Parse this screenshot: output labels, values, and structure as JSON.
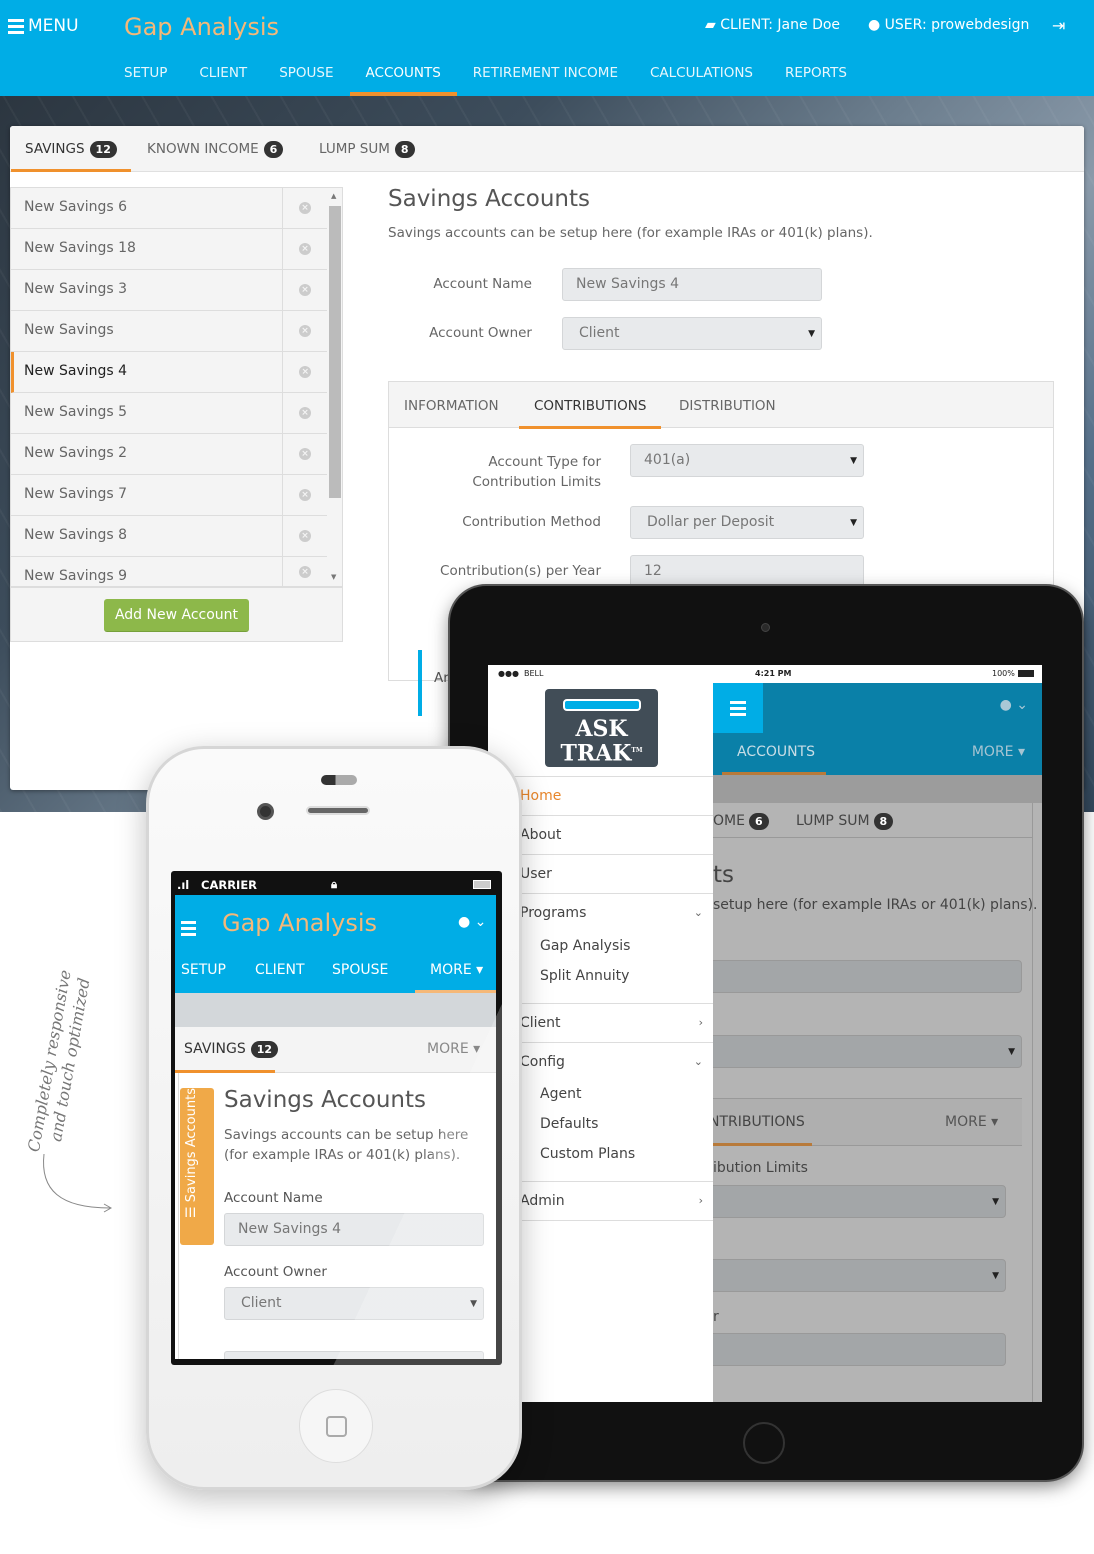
{
  "header": {
    "menu_label": "MENU",
    "app_title": "Gap Analysis",
    "client_label": "CLIENT: Jane Doe",
    "user_label": "USER: prowebdesign",
    "nav_tabs": [
      "SETUP",
      "CLIENT",
      "SPOUSE",
      "ACCOUNTS",
      "RETIREMENT INCOME",
      "CALCULATIONS",
      "REPORTS"
    ],
    "active_tab": "ACCOUNTS"
  },
  "subtabs": [
    {
      "label": "SAVINGS",
      "count": "12"
    },
    {
      "label": "KNOWN INCOME",
      "count": "6"
    },
    {
      "label": "LUMP SUM",
      "count": "8"
    }
  ],
  "accounts_list": {
    "items": [
      "New Savings 6",
      "New Savings 18",
      "New Savings 3",
      "New Savings",
      "New Savings 4",
      "New Savings 5",
      "New Savings 2",
      "New Savings 7",
      "New Savings 8",
      "New Savings 9"
    ],
    "selected": "New Savings 4",
    "add_button": "Add New Account"
  },
  "form": {
    "title": "Savings Accounts",
    "description": "Savings accounts can be setup here (for example IRAs or 401(k) plans).",
    "account_name_label": "Account Name",
    "account_name_value": "New Savings 4",
    "account_owner_label": "Account Owner",
    "account_owner_value": "Client",
    "inner_tabs": [
      "INFORMATION",
      "CONTRIBUTIONS",
      "DISTRIBUTION"
    ],
    "inner_active": "CONTRIBUTIONS",
    "account_type_label_1": "Account Type for",
    "account_type_label_2": "Contribution Limits",
    "account_type_value": "401(a)",
    "contribution_method_label": "Contribution Method",
    "contribution_method_value": "Dollar per Deposit",
    "contributions_per_year_label": "Contribution(s) per Year",
    "contributions_per_year_value": "12",
    "partial_label": "Ar"
  },
  "tablet": {
    "carrier": "BELL",
    "time": "4:21 PM",
    "battery": "100%",
    "logo_line1": "ASK",
    "logo_line2": "TRAK",
    "logo_tm": "TM",
    "header_tab": "ACCOUNTS",
    "more_label": "MORE",
    "drawer": {
      "items": [
        {
          "label": "Home",
          "active": true
        },
        {
          "label": "About"
        },
        {
          "label": "User"
        },
        {
          "label": "Programs",
          "expanded": true,
          "children": [
            "Gap Analysis",
            "Split Annuity"
          ]
        },
        {
          "label": "Client",
          "has_children": true
        },
        {
          "label": "Config",
          "expanded": true,
          "children": [
            "Agent",
            "Defaults",
            "Custom Plans"
          ]
        },
        {
          "label": "Admin",
          "has_children": true
        }
      ]
    },
    "bg_subtab_partial": "OME",
    "bg_subtab_partial_count": "6",
    "bg_subtab_lump": "LUMP SUM",
    "bg_subtab_lump_count": "8",
    "bg_title_partial": "ts",
    "bg_desc_partial": "setup here (for example IRAs or 401(k) plans).",
    "bg_inner_tab_partial": "NTRIBUTIONS",
    "bg_label_partial": "ibution Limits",
    "bg_label_partial2": "r"
  },
  "phone": {
    "carrier": "CARRIER",
    "app_title": "Gap Analysis",
    "nav_tabs": [
      "SETUP",
      "CLIENT",
      "SPOUSE"
    ],
    "more_label": "MORE",
    "subtab_label": "SAVINGS",
    "subtab_count": "12",
    "subtab_more": "MORE",
    "side_tab": "Savings Accounts",
    "title": "Savings Accounts",
    "description_1": "Savings accounts can be setup here",
    "description_2": "(for example IRAs or 401(k) plans).",
    "account_name_label": "Account Name",
    "account_name_value": "New Savings 4",
    "account_owner_label": "Account Owner",
    "account_owner_value": "Client"
  },
  "annotation": {
    "line1": "Completely responsive",
    "line2": "and touch optimized"
  },
  "colors": {
    "primary": "#00ade6",
    "accent": "#f0912d",
    "title": "#f5b878",
    "button_green": "#8db84a"
  }
}
